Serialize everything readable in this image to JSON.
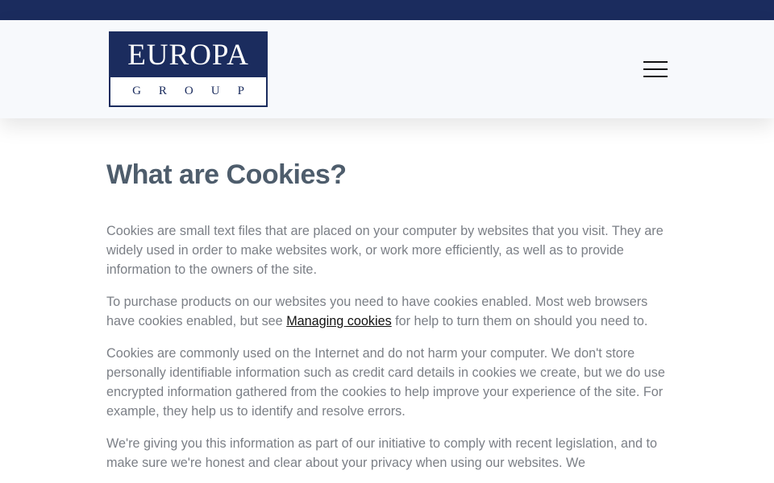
{
  "header": {
    "logo": {
      "name": "EUROPA",
      "group": "GROUP"
    },
    "menu_icon": "hamburger-menu-icon"
  },
  "main": {
    "title": "What are Cookies?",
    "paragraphs": {
      "p1": "Cookies are small text files that are placed on your computer by websites that you visit. They are widely used in order to make websites work, or work more efficiently, as well as to provide information to the owners of the site.",
      "p2_before": "To purchase products on our websites you need to have cookies enabled. Most web browsers have cookies enabled, but see ",
      "p2_link": "Managing cookies",
      "p2_after": " for help to turn them on should you need to.",
      "p3": "Cookies are commonly used on the Internet and do not harm your computer. We don't store personally identifiable information such as credit card details in cookies we create, but we do use encrypted information gathered from the cookies to help improve your experience of the site. For example, they help us to identify and resolve errors.",
      "p4": "We're giving you this information as part of our initiative to comply with recent legislation, and to make sure we're honest and clear about your privacy when using our websites. We"
    }
  },
  "colors": {
    "brand_navy": "#1b2c5e",
    "header_bg": "#f7f9fc",
    "title": "#4e5d6c",
    "body_text": "#7b7f86",
    "link": "#111111"
  }
}
